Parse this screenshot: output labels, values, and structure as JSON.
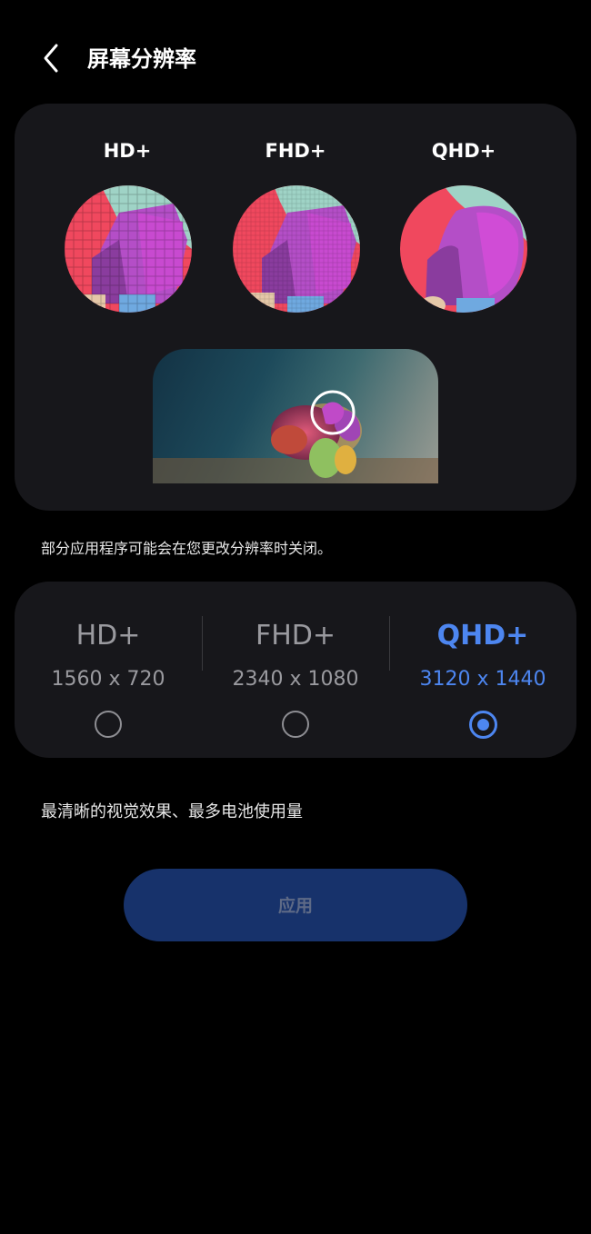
{
  "header": {
    "title": "屏幕分辨率",
    "back_icon": "chevron-left-icon"
  },
  "preview": {
    "labels": [
      "HD+",
      "FHD+",
      "QHD+"
    ]
  },
  "note": "部分应用程序可能会在您更改分辨率时关闭。",
  "options": [
    {
      "name": "HD+",
      "size": "1560 x 720",
      "selected": false
    },
    {
      "name": "FHD+",
      "size": "2340 x 1080",
      "selected": false
    },
    {
      "name": "QHD+",
      "size": "3120 x 1440",
      "selected": true
    }
  ],
  "description": "最清晰的视觉效果、最多电池使用量",
  "apply_button": {
    "label": "应用"
  },
  "colors": {
    "accent": "#4d86f0",
    "card": "#17171b",
    "button": "#17326b"
  }
}
